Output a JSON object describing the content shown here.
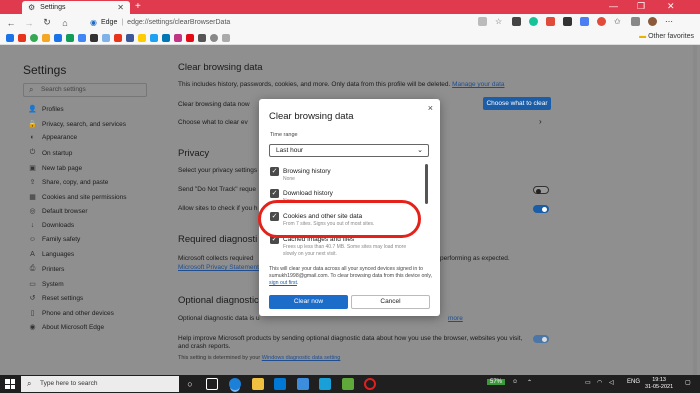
{
  "browser": {
    "tab_title": "Settings",
    "new_tab": "+",
    "address_brand": "Edge",
    "address_separator": "|",
    "address_path": "edge://settings/clearBrowserData",
    "other_favorites": "Other favorites",
    "window_controls": [
      "—",
      "❐",
      "✕"
    ],
    "colors": {
      "titlebar": "#e03a4e"
    }
  },
  "sidebar": {
    "title": "Settings",
    "search_placeholder": "Search settings",
    "items": [
      {
        "icon": "profile-icon",
        "glyph": "👤",
        "label": "Profiles"
      },
      {
        "icon": "lock-icon",
        "glyph": "🔒",
        "label": "Privacy, search, and services"
      },
      {
        "icon": "appearance-icon",
        "glyph": "◐",
        "label": "Appearance"
      },
      {
        "icon": "power-icon",
        "glyph": "⏻",
        "label": "On startup"
      },
      {
        "icon": "new-tab-icon",
        "glyph": "▣",
        "label": "New tab page"
      },
      {
        "icon": "share-icon",
        "glyph": "⇪",
        "label": "Share, copy, and paste"
      },
      {
        "icon": "cookies-icon",
        "glyph": "▦",
        "label": "Cookies and site permissions"
      },
      {
        "icon": "browser-icon",
        "glyph": "◎",
        "label": "Default browser"
      },
      {
        "icon": "download-icon",
        "glyph": "↓",
        "label": "Downloads"
      },
      {
        "icon": "family-icon",
        "glyph": "☺",
        "label": "Family safety"
      },
      {
        "icon": "languages-icon",
        "glyph": "A",
        "label": "Languages"
      },
      {
        "icon": "printer-icon",
        "glyph": "⎙",
        "label": "Printers"
      },
      {
        "icon": "system-icon",
        "glyph": "▭",
        "label": "System"
      },
      {
        "icon": "reset-icon",
        "glyph": "↺",
        "label": "Reset settings"
      },
      {
        "icon": "phone-icon",
        "glyph": "▯",
        "label": "Phone and other devices"
      },
      {
        "icon": "edge-icon",
        "glyph": "◉",
        "label": "About Microsoft Edge"
      }
    ]
  },
  "main": {
    "clear_heading": "Clear browsing data",
    "clear_desc": "This includes history, passwords, cookies, and more. Only data from this profile will be deleted.",
    "manage_link": "Manage your data",
    "clear_now_label": "Clear browsing data now",
    "choose_button": "Choose what to clear",
    "choose_every_label": "Choose what to clear ev",
    "privacy_heading": "Privacy",
    "privacy_desc": "Select your privacy settings f",
    "dnt_label": "Send \"Do Not Track\" reque",
    "allow_sites_label": "Allow sites to check if you h",
    "required_heading": "Required diagnosti",
    "required_desc": "Microsoft collects required",
    "required_desc_end": "performing as expected.",
    "privacy_statement_link": "Microsoft Privacy Statement",
    "optional_heading": "Optional diagnostic",
    "optional_desc": "Optional diagnostic data is u",
    "optional_learn_more": "more",
    "help_improve": "Help improve Microsoft products by sending optional diagnostic data about how you use the browser, websites you visit, and crash reports.",
    "setting_determined": "This setting is determined by your",
    "windows_diag_link": "Windows diagnostic data setting",
    "colors": {
      "accent": "#1c5da8"
    }
  },
  "dialog": {
    "title": "Clear browsing data",
    "close": "×",
    "time_range_label": "Time range",
    "time_range_value": "Last hour",
    "items": [
      {
        "label": "Browsing history",
        "sub": "None",
        "checked": true
      },
      {
        "label": "Download history",
        "sub": "None",
        "checked": true
      },
      {
        "label": "Cookies and other site data",
        "sub": "From 7 sites. Signs you out of most sites.",
        "checked": true
      },
      {
        "label": "Cached images and files",
        "sub": "Frees up less than 40.7 MB. Some sites may load more slowly on your next visit.",
        "checked": true
      }
    ],
    "note": "This will clear your data across all your synced devices signed in to sumukh1998@gmail.com. To clear browsing data from this device only,",
    "sign_out_link": "sign out first",
    "clear_now": "Clear now",
    "cancel": "Cancel",
    "highlight_color": "#e5221a"
  },
  "taskbar": {
    "search_placeholder": "Type here to search",
    "battery": "57%",
    "language": "ENG",
    "time": "19:13",
    "date": "31-05-2021"
  }
}
